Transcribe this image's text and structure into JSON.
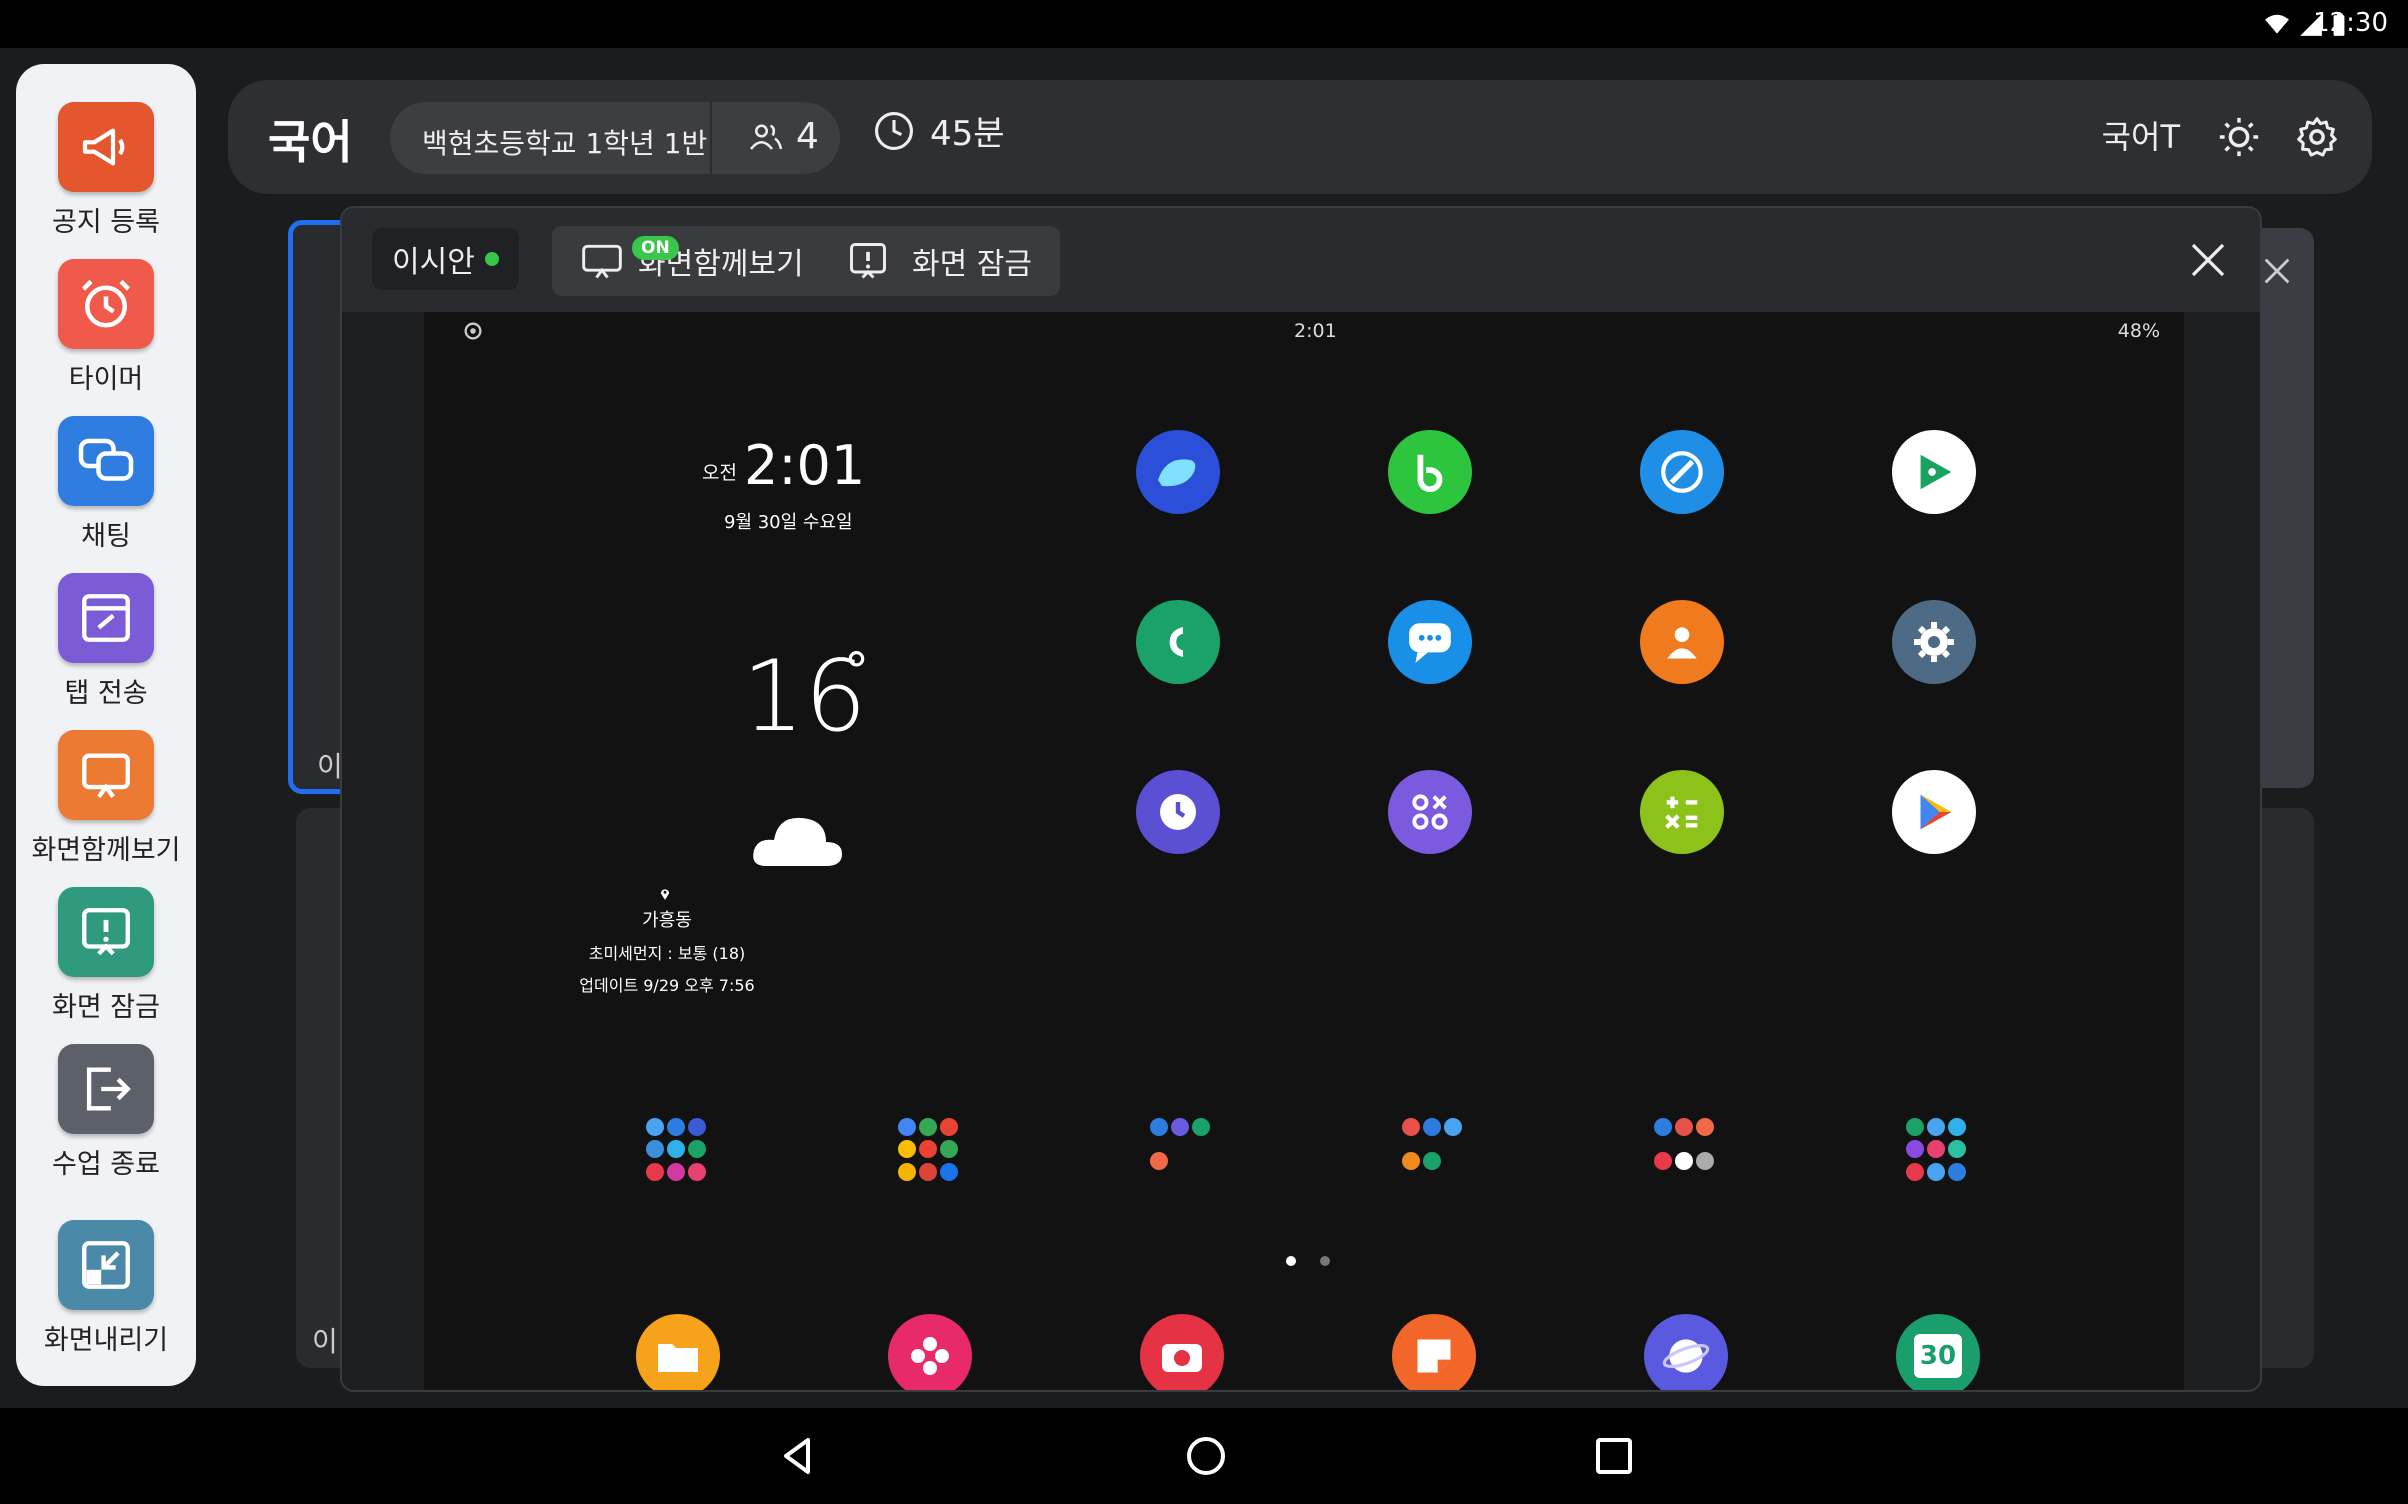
{
  "status_bar": {
    "time": "12:30",
    "icons": [
      "wifi-icon",
      "signal-icon",
      "battery-icon"
    ]
  },
  "sidebar": {
    "items": [
      {
        "label": "공지 등록",
        "icon": "megaphone-icon",
        "color": "#e4572e"
      },
      {
        "label": "타이머",
        "icon": "alarm-clock-icon",
        "color": "#ef5a4a"
      },
      {
        "label": "채팅",
        "icon": "chat-bubbles-icon",
        "color": "#2f7de1"
      },
      {
        "label": "탭 전송",
        "icon": "link-tab-icon",
        "color": "#7b5bd6"
      },
      {
        "label": "화면함께보기",
        "icon": "screen-share-icon",
        "color": "#ec7a33"
      },
      {
        "label": "화면 잠금",
        "icon": "screen-lock-icon",
        "color": "#2f9a7e"
      },
      {
        "label": "수업 종료",
        "icon": "exit-icon",
        "color": "#5c6068"
      },
      {
        "label": "화면내리기",
        "icon": "minimize-icon",
        "color": "#4a8aa8"
      }
    ]
  },
  "topbar": {
    "subject": "국어",
    "class_name": "백현초등학교 1학년 1반",
    "student_count": "4",
    "duration": "45분",
    "teacher": "국어T",
    "icons": [
      "people-icon",
      "clock-icon",
      "brightness-icon",
      "settings-icon"
    ]
  },
  "background_tiles": {
    "label_1": "이",
    "label_2": "이"
  },
  "popup": {
    "student_name": "이시안",
    "status_color": "#3ac54b",
    "share_badge": "ON",
    "share_label": "화면함께보기",
    "lock_label": "화면 잠금"
  },
  "device_screen": {
    "status_time": "2:01",
    "battery": "48%",
    "clock_ampm": "오전",
    "clock_time": "2:01",
    "date": "9월 30일 수요일",
    "temperature": "16",
    "degree": "°",
    "location": "가흥동",
    "air_quality": "초미세먼지 : 보통 (18)",
    "updated": "업데이트 9/29 오후 7:56",
    "apps": [
      {
        "name": "whale-browser-icon",
        "color": "#2b4fd8"
      },
      {
        "name": "band-icon",
        "color": "#2cc53d"
      },
      {
        "name": "guitar-app-icon",
        "color": "#1e8ee6"
      },
      {
        "name": "play-games-icon",
        "color": "#ffffff"
      },
      {
        "name": "phone-icon",
        "color": "#1aa268"
      },
      {
        "name": "messages-icon",
        "color": "#1a8fe8"
      },
      {
        "name": "contacts-icon",
        "color": "#f07a1e"
      },
      {
        "name": "settings-app-icon",
        "color": "#4d6b85"
      },
      {
        "name": "clock-app-icon",
        "color": "#5b4fd4"
      },
      {
        "name": "game-launcher-icon",
        "color": "#7c5ae0"
      },
      {
        "name": "calculator-icon",
        "color": "#8cc21a"
      },
      {
        "name": "play-store-icon",
        "color": "#ffffff"
      }
    ],
    "dock": [
      {
        "name": "my-files-icon",
        "color": "#f7a21b"
      },
      {
        "name": "gallery-icon",
        "color": "#e8296a"
      },
      {
        "name": "camera-icon",
        "color": "#e53245"
      },
      {
        "name": "notes-icon",
        "color": "#f2662a"
      },
      {
        "name": "internet-icon",
        "color": "#5a5ae0"
      },
      {
        "name": "calendar-icon",
        "color": "#1a9e6c"
      }
    ],
    "calendar_day": "30"
  },
  "navbar": {
    "icons": [
      "back-icon",
      "home-icon",
      "recents-icon"
    ]
  }
}
